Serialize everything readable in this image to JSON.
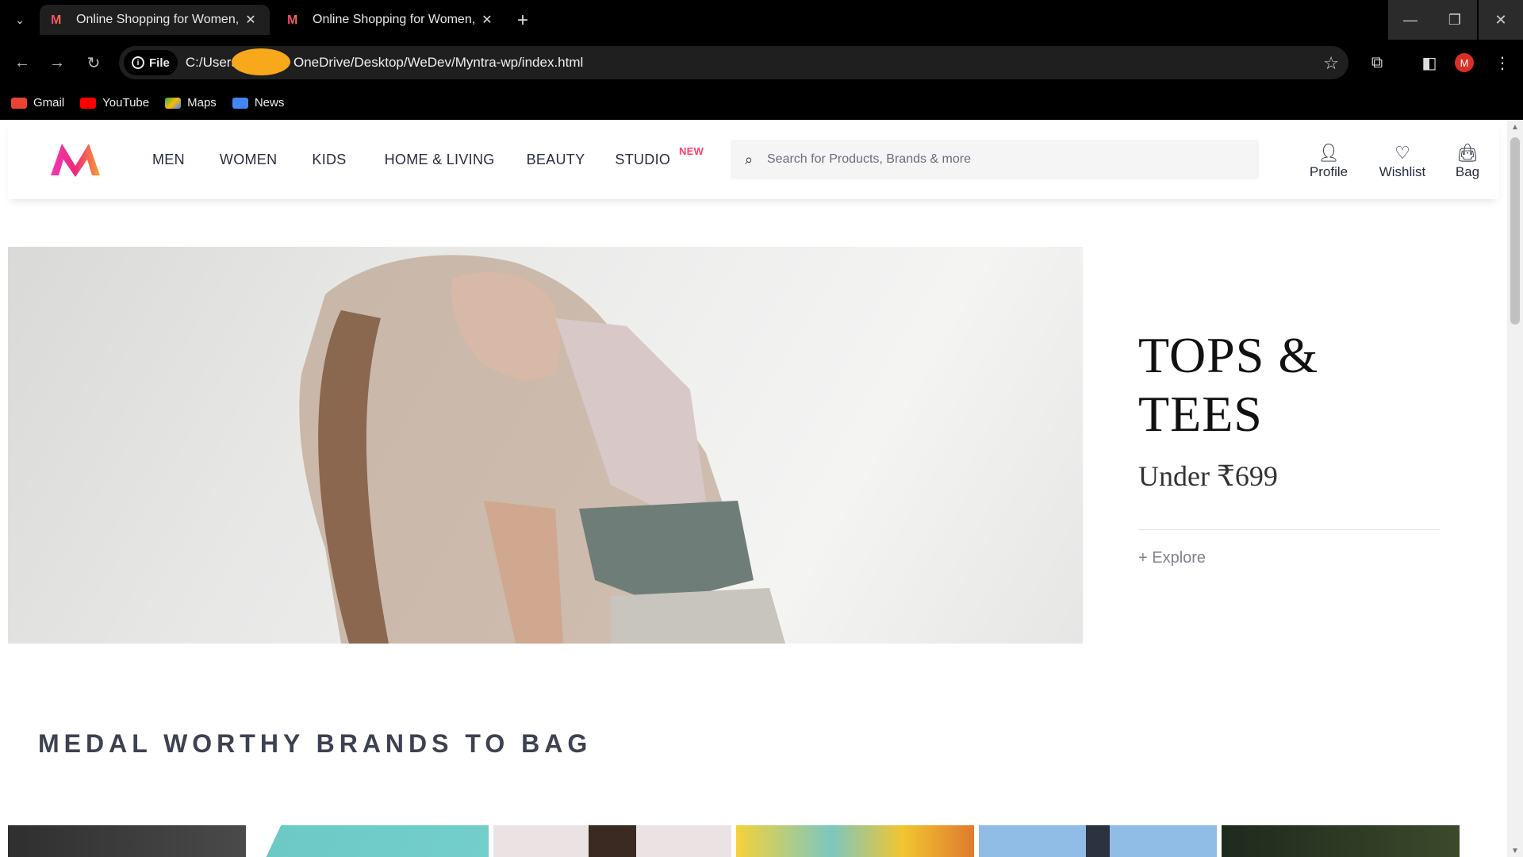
{
  "browser": {
    "tabs": [
      {
        "title": "Online Shopping for Women, M",
        "active": true
      },
      {
        "title": "Online Shopping for Women, M",
        "active": false
      }
    ],
    "site_chip": "File",
    "url_prefix": "C:/Users",
    "url_suffix": "OneDrive/Desktop/WeDev/Myntra-wp/index.html",
    "profile_initial": "M",
    "bookmarks": [
      {
        "label": "Gmail",
        "color": "#ea4335"
      },
      {
        "label": "YouTube",
        "color": "#ff0000"
      },
      {
        "label": "Maps",
        "color": "#34a853"
      },
      {
        "label": "News",
        "color": "#4285f4"
      }
    ]
  },
  "header": {
    "nav": [
      "MEN",
      "WOMEN",
      "KIDS",
      "HOME & LIVING",
      "BEAUTY",
      "STUDIO"
    ],
    "studio_badge": "NEW",
    "search_placeholder": "Search for Products, Brands & more",
    "actions": {
      "profile": "Profile",
      "wishlist": "Wishlist",
      "bag": "Bag"
    }
  },
  "hero": {
    "title": "TOPS & TEES",
    "subtitle": "Under ₹699",
    "cta": "+ Explore"
  },
  "section": {
    "title": "MEDAL WORTHY BRANDS TO BAG"
  },
  "colors": {
    "accent": "#ff3f6c",
    "text": "#282c3f"
  }
}
